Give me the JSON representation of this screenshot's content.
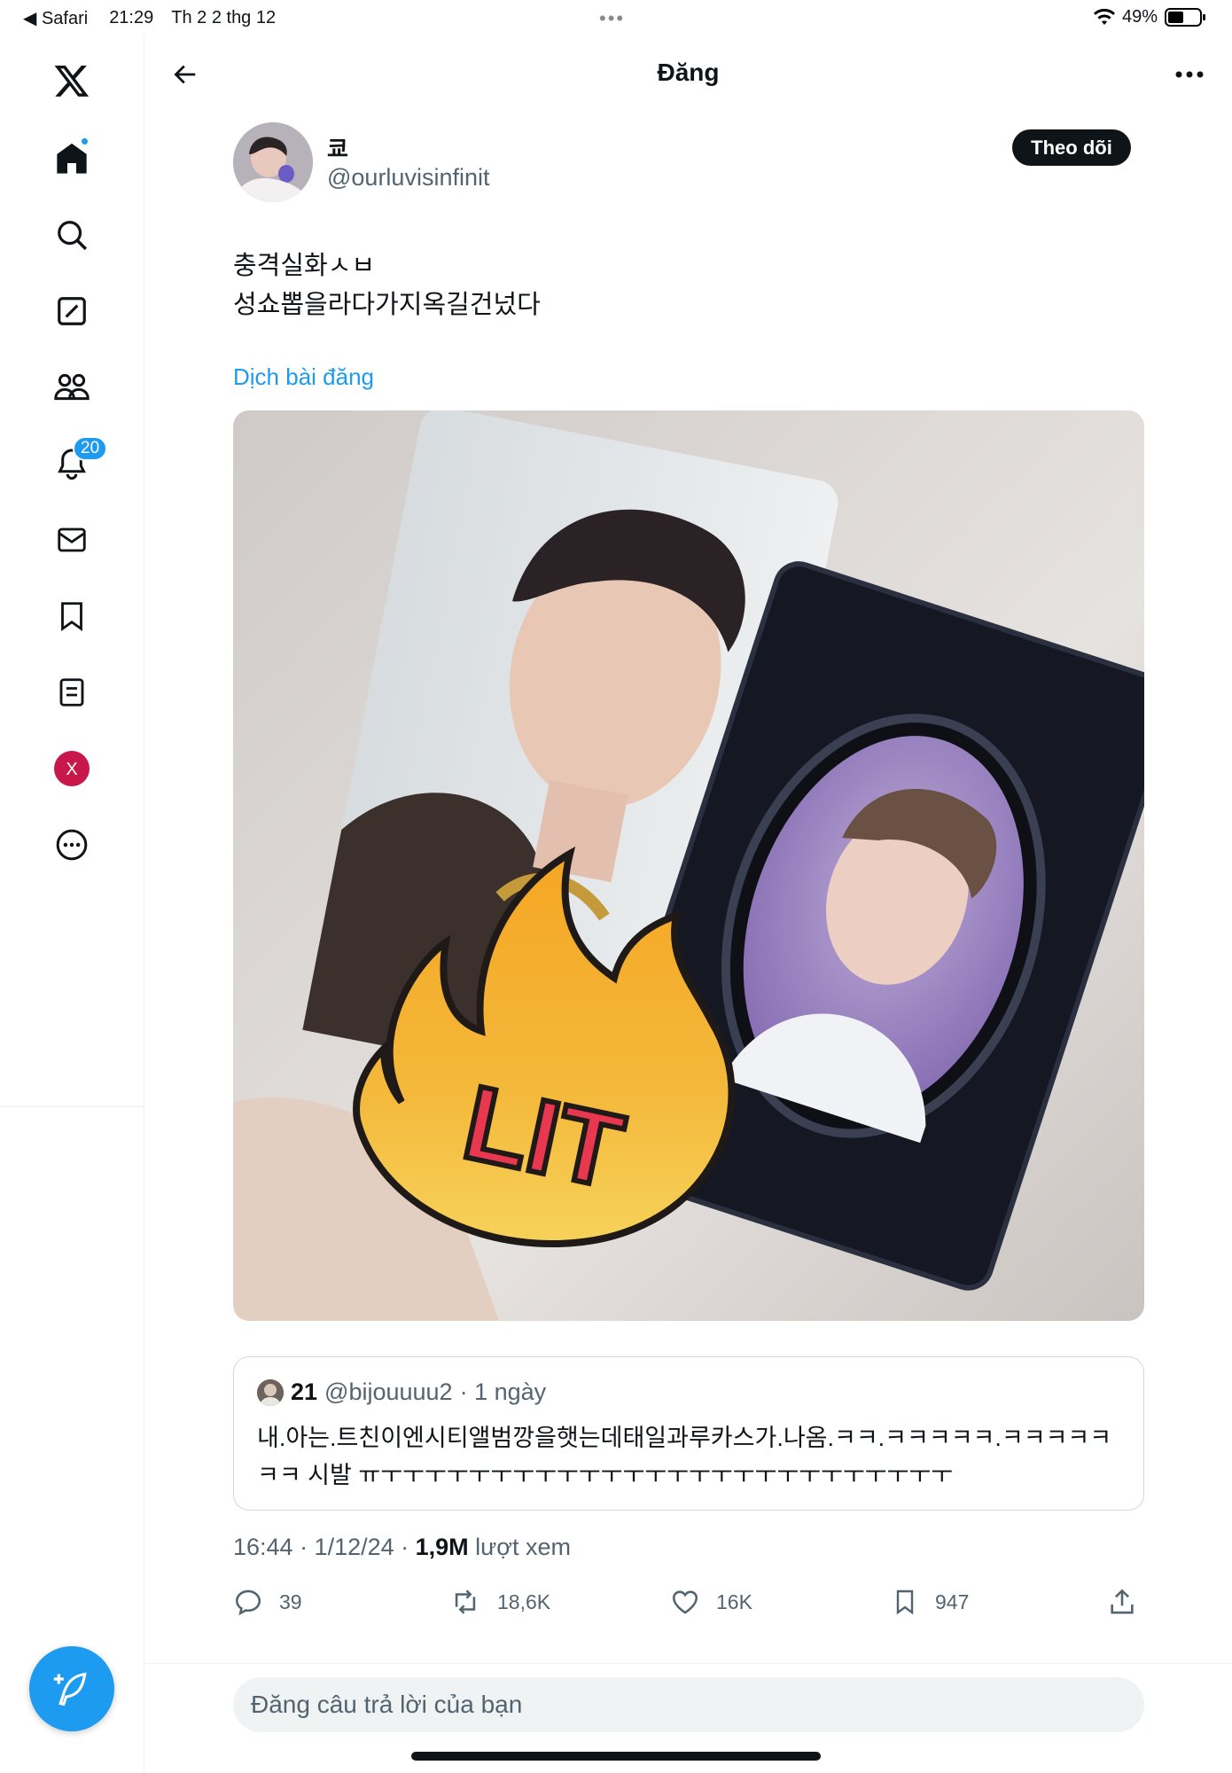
{
  "statusbar": {
    "back_app": "◀ Safari",
    "time": "21:29",
    "date": "Th 2 2 thg 12",
    "battery": "49%",
    "battery_level": 0.49
  },
  "sidebar": {
    "items": [
      {
        "icon": "x-logo-icon"
      },
      {
        "icon": "home-icon",
        "has_dot": true
      },
      {
        "icon": "search-icon"
      },
      {
        "icon": "grok-icon"
      },
      {
        "icon": "communities-icon"
      },
      {
        "icon": "notifications-icon",
        "badge": "20"
      },
      {
        "icon": "messages-icon"
      },
      {
        "icon": "bookmarks-icon"
      },
      {
        "icon": "lists-icon"
      },
      {
        "icon": "profile-avatar",
        "label": "X"
      },
      {
        "icon": "more-icon"
      }
    ],
    "compose_icon": "feather-plus-icon"
  },
  "header": {
    "title": "Đăng"
  },
  "tweet": {
    "name": "쿄",
    "handle": "@ourluvisinfinit",
    "follow_label": "Theo dõi",
    "text": "충격실화ㅅㅂ\n성쇼뽑을라다가지옥길건넜다",
    "translate_label": "Dịch bài đăng",
    "media_alt": "Two photocards with a LIT flame sticker",
    "sticker_text": "LIT",
    "timestamp": "16:44 · 1/12/24 · ",
    "views_count": "1,9M",
    "views_label": " lượt xem"
  },
  "quote": {
    "name": "21",
    "handle": "@bijouuuu2",
    "meta": "· 1 ngày",
    "text": "내.아는.트친이엔시티앨범깡을햇는데태일과루카스가.나옴.ㅋㅋ.ㅋㅋㅋㅋㅋ.ㅋㅋㅋㅋㅋㅋㅋ 시발 ㅠㅜㅜㅜㅜㅜㅜㅜㅜㅜㅜㅜㅜㅜㅜㅜㅜㅜㅜㅜㅜㅜㅜㅜㅜㅜㅜ"
  },
  "actions": {
    "replies": "39",
    "reposts": "18,6K",
    "likes": "16K",
    "bookmarks": "947"
  },
  "reply": {
    "placeholder": "Đăng câu trả lời của bạn"
  },
  "colors": {
    "accent": "#1d9bf0",
    "text": "#0f1419",
    "muted": "#536471"
  }
}
